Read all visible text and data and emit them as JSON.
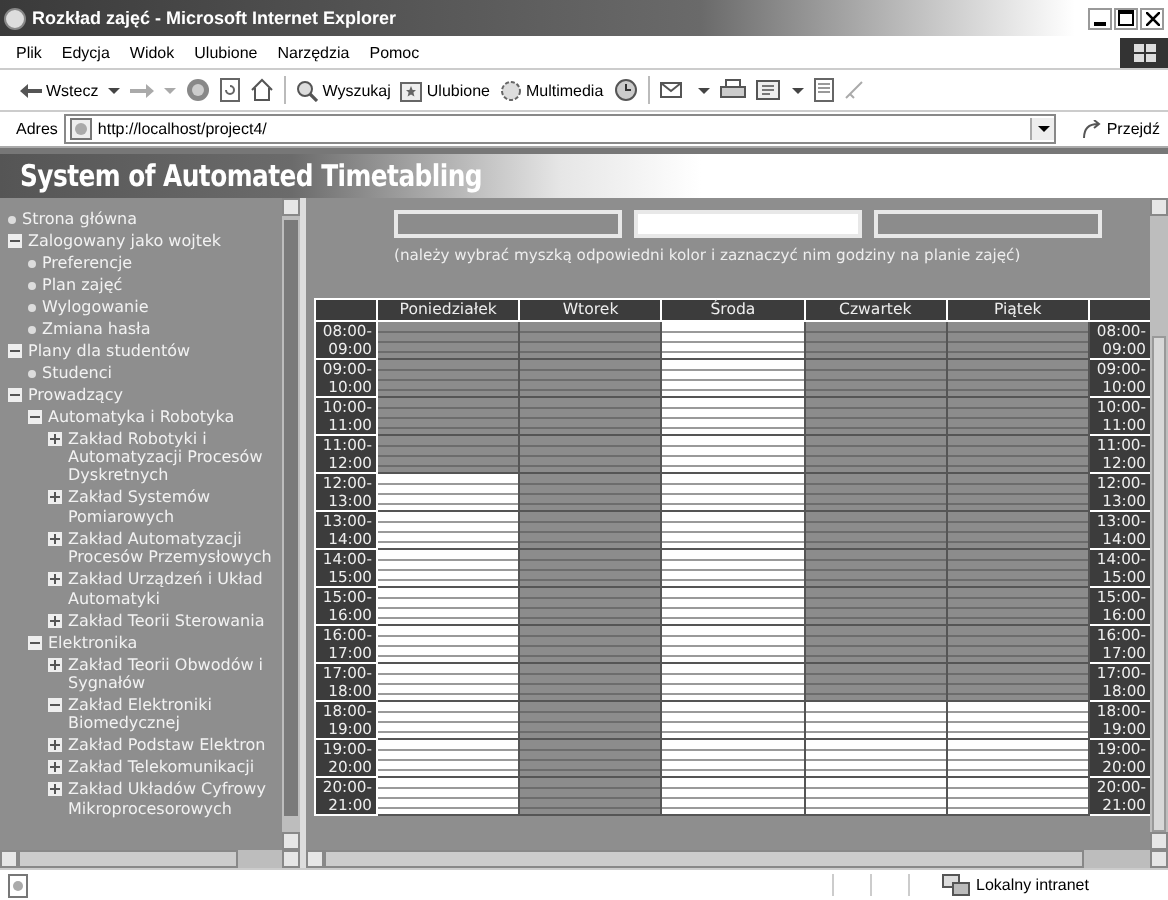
{
  "window": {
    "title": "Rozkład zajęć - Microsoft Internet Explorer"
  },
  "menu": [
    "Plik",
    "Edycja",
    "Widok",
    "Ulubione",
    "Narzędzia",
    "Pomoc"
  ],
  "toolbar": {
    "back": "Wstecz",
    "search": "Wyszukaj",
    "favorites": "Ulubione",
    "media": "Multimedia"
  },
  "address": {
    "label": "Adres",
    "value": "http://localhost/project4/",
    "go": "Przejdź"
  },
  "banner": "System of Automated Timetabling",
  "sidebar": {
    "items": [
      {
        "kind": "link",
        "label": "Strona główna"
      },
      {
        "kind": "folder",
        "label": "Zalogowany jako wojtek",
        "expanded": true,
        "children": [
          {
            "kind": "link",
            "label": "Preferencje"
          },
          {
            "kind": "link",
            "label": "Plan zajęć"
          },
          {
            "kind": "link",
            "label": "Wylogowanie"
          },
          {
            "kind": "link",
            "label": "Zmiana hasła"
          }
        ]
      },
      {
        "kind": "folder",
        "label": "Plany dla studentów",
        "expanded": true,
        "children": [
          {
            "kind": "link",
            "label": "Studenci"
          }
        ]
      },
      {
        "kind": "folder",
        "label": "Prowadzący",
        "expanded": true,
        "children": [
          {
            "kind": "folder",
            "label": "Automatyka i Robotyka",
            "expanded": true,
            "children": [
              {
                "kind": "folder",
                "label": "Zakład Robotyki i Automatyzacji Procesów Dyskretnych",
                "expanded": false
              },
              {
                "kind": "folder",
                "label": "Zakład Systemów Pomiarowych",
                "expanded": false
              },
              {
                "kind": "folder",
                "label": "Zakład Automatyzacji Procesów Przemysłowych",
                "expanded": false
              },
              {
                "kind": "folder",
                "label": "Zakład Urządzeń i Układ Automatyki",
                "expanded": false
              },
              {
                "kind": "folder",
                "label": "Zakład Teorii Sterowania",
                "expanded": false
              }
            ]
          },
          {
            "kind": "folder",
            "label": "Elektronika",
            "expanded": true,
            "children": [
              {
                "kind": "folder",
                "label": "Zakład Teorii Obwodów i Sygnałów",
                "expanded": false
              },
              {
                "kind": "folder",
                "label": "Zakład Elektroniki Biomedycznej",
                "expanded": true
              },
              {
                "kind": "folder",
                "label": "Zakład Podstaw Elektron",
                "expanded": false
              },
              {
                "kind": "folder",
                "label": "Zakład Telekomunikacji",
                "expanded": false
              },
              {
                "kind": "folder",
                "label": "Zakład Układów Cyfrowy Mikroprocesorowych",
                "expanded": false
              }
            ]
          }
        ]
      }
    ]
  },
  "availability": {
    "swatches": [
      {
        "color": "#8c8c8c"
      },
      {
        "color": "#ffffff"
      },
      {
        "color": "#8c8c8c"
      }
    ],
    "hint": "(należy wybrać myszką odpowiedni kolor i zaznaczyć nim godziny na planie zajęć)"
  },
  "timetable": {
    "days": [
      "Poniedziałek",
      "Wtorek",
      "Środa",
      "Czwartek",
      "Piątek"
    ],
    "rows": [
      {
        "left": "08:00-\n09:00",
        "right": "08:00-\n09:00",
        "free": [
          false,
          false,
          true,
          false,
          false
        ]
      },
      {
        "left": "09:00-\n10:00",
        "right": "09:00-\n10:00",
        "free": [
          false,
          false,
          true,
          false,
          false
        ]
      },
      {
        "left": "10:00-\n11:00",
        "right": "10:00-\n11:00",
        "free": [
          false,
          false,
          true,
          false,
          false
        ]
      },
      {
        "left": "11:00-\n12:00",
        "right": "11:00-\n12:00",
        "free": [
          false,
          false,
          true,
          false,
          false
        ]
      },
      {
        "left": "12:00-\n13:00",
        "right": "12:00-\n13:00",
        "free": [
          true,
          false,
          true,
          false,
          false
        ]
      },
      {
        "left": "13:00-\n14:00",
        "right": "13:00-\n14:00",
        "free": [
          true,
          false,
          true,
          false,
          false
        ]
      },
      {
        "left": "14:00-\n15:00",
        "right": "14:00-\n15:00",
        "free": [
          true,
          false,
          true,
          false,
          false
        ]
      },
      {
        "left": "15:00-\n16:00",
        "right": "15:00-\n16:00",
        "free": [
          true,
          false,
          true,
          false,
          false
        ]
      },
      {
        "left": "16:00-\n17:00",
        "right": "16:00-\n17:00",
        "free": [
          true,
          false,
          true,
          false,
          false
        ]
      },
      {
        "left": "17:00-\n18:00",
        "right": "17:00-\n18:00",
        "free": [
          true,
          false,
          true,
          false,
          false
        ]
      },
      {
        "left": "18:00-\n19:00",
        "right": "18:00-\n19:00",
        "free": [
          true,
          false,
          true,
          true,
          true
        ]
      },
      {
        "left": "19:00-\n20:00",
        "right": "19:00-\n20:00",
        "free": [
          true,
          false,
          true,
          true,
          true
        ]
      },
      {
        "left": "20:00-\n21:00",
        "right": "20:00-\n21:00",
        "free": [
          true,
          false,
          true,
          true,
          true
        ]
      }
    ]
  },
  "status_bar": {
    "zone": "Lokalny intranet"
  }
}
